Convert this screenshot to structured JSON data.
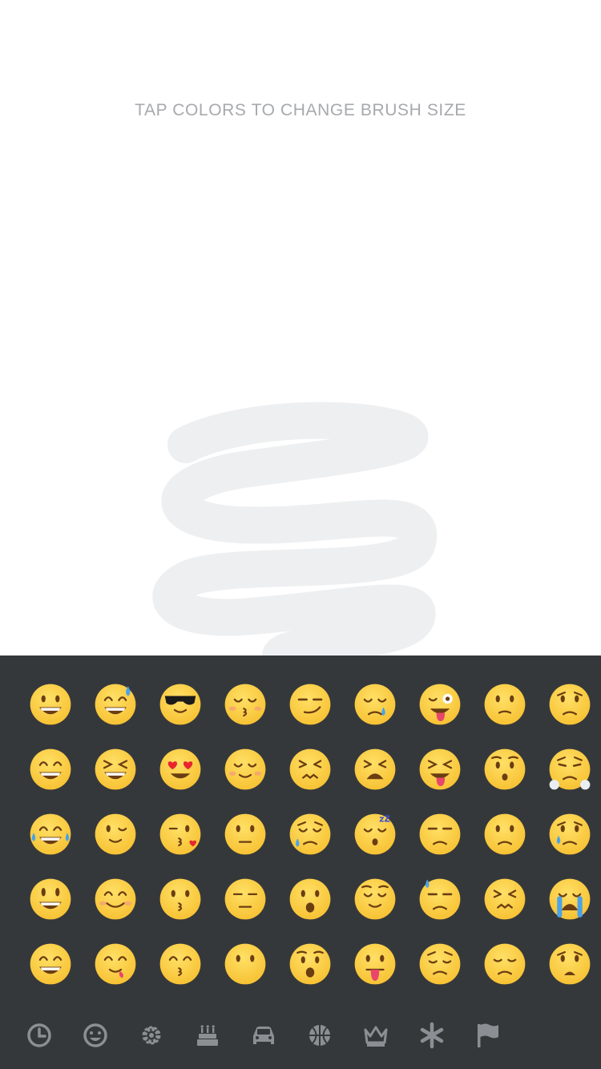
{
  "canvas": {
    "hint_text": "TAP COLORS TO CHANGE BRUSH SIZE",
    "stroke_color": "#eeeff1"
  },
  "keyboard": {
    "background": "#35383b",
    "face_color": "#f7c234",
    "category_icon_color": "#8b8f93",
    "emojis": [
      {
        "name": "grinning"
      },
      {
        "name": "sweat-smile"
      },
      {
        "name": "sunglasses"
      },
      {
        "name": "kissing-closed-eyes"
      },
      {
        "name": "smirk"
      },
      {
        "name": "sleepy"
      },
      {
        "name": "stuck-out-tongue-winking-eye"
      },
      {
        "name": "confused"
      },
      {
        "name": "worried"
      },
      {
        "name": "grin"
      },
      {
        "name": "laughing"
      },
      {
        "name": "heart-eyes"
      },
      {
        "name": "relaxed"
      },
      {
        "name": "confounded"
      },
      {
        "name": "tired-face"
      },
      {
        "name": "stuck-out-tongue-closed-eyes"
      },
      {
        "name": "hushed"
      },
      {
        "name": "triumph"
      },
      {
        "name": "joy"
      },
      {
        "name": "wink"
      },
      {
        "name": "kissing-heart"
      },
      {
        "name": "neutral-face"
      },
      {
        "name": "disappointed-relieved"
      },
      {
        "name": "sleeping"
      },
      {
        "name": "unamused"
      },
      {
        "name": "frowning"
      },
      {
        "name": "cry"
      },
      {
        "name": "smiley"
      },
      {
        "name": "blush"
      },
      {
        "name": "kissing"
      },
      {
        "name": "expressionless"
      },
      {
        "name": "open-mouth"
      },
      {
        "name": "relieved"
      },
      {
        "name": "sweat"
      },
      {
        "name": "persevere"
      },
      {
        "name": "sob"
      },
      {
        "name": "smile"
      },
      {
        "name": "yum"
      },
      {
        "name": "kissing-smiling-eyes"
      },
      {
        "name": "no-mouth"
      },
      {
        "name": "astonished"
      },
      {
        "name": "stuck-out-tongue"
      },
      {
        "name": "pensive"
      },
      {
        "name": "disappointed"
      },
      {
        "name": "anguished"
      }
    ],
    "categories": [
      {
        "name": "recent-clock",
        "selected": false
      },
      {
        "name": "smileys",
        "selected": true
      },
      {
        "name": "nature-gear",
        "selected": false
      },
      {
        "name": "food-cake",
        "selected": false
      },
      {
        "name": "travel-car",
        "selected": false
      },
      {
        "name": "activity-ball",
        "selected": false
      },
      {
        "name": "objects-crown",
        "selected": false
      },
      {
        "name": "symbols-asterisk",
        "selected": false
      },
      {
        "name": "flags",
        "selected": false
      }
    ]
  }
}
